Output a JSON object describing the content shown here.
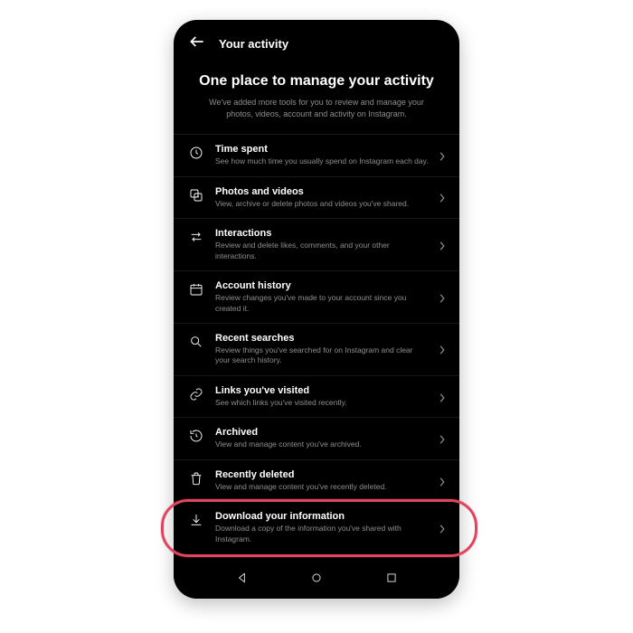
{
  "header": {
    "title": "Your activity"
  },
  "hero": {
    "title": "One place to manage your activity",
    "subtitle": "We've added more tools for you to review and manage your photos, videos, account and activity on Instagram."
  },
  "items": [
    {
      "title": "Time spent",
      "subtitle": "See how much time you usually spend on Instagram each day."
    },
    {
      "title": "Photos and videos",
      "subtitle": "View, archive or delete photos and videos you've shared."
    },
    {
      "title": "Interactions",
      "subtitle": "Review and delete likes, comments, and your other interactions."
    },
    {
      "title": "Account history",
      "subtitle": "Review changes you've made to your account since you created it."
    },
    {
      "title": "Recent searches",
      "subtitle": "Review things you've searched for on Instagram and clear your search history."
    },
    {
      "title": "Links you've visited",
      "subtitle": "See which links you've visited recently."
    },
    {
      "title": "Archived",
      "subtitle": "View and manage content you've archived."
    },
    {
      "title": "Recently deleted",
      "subtitle": "View and manage content you've recently deleted."
    },
    {
      "title": "Download your information",
      "subtitle": "Download a copy of the information you've shared with Instagram."
    }
  ]
}
